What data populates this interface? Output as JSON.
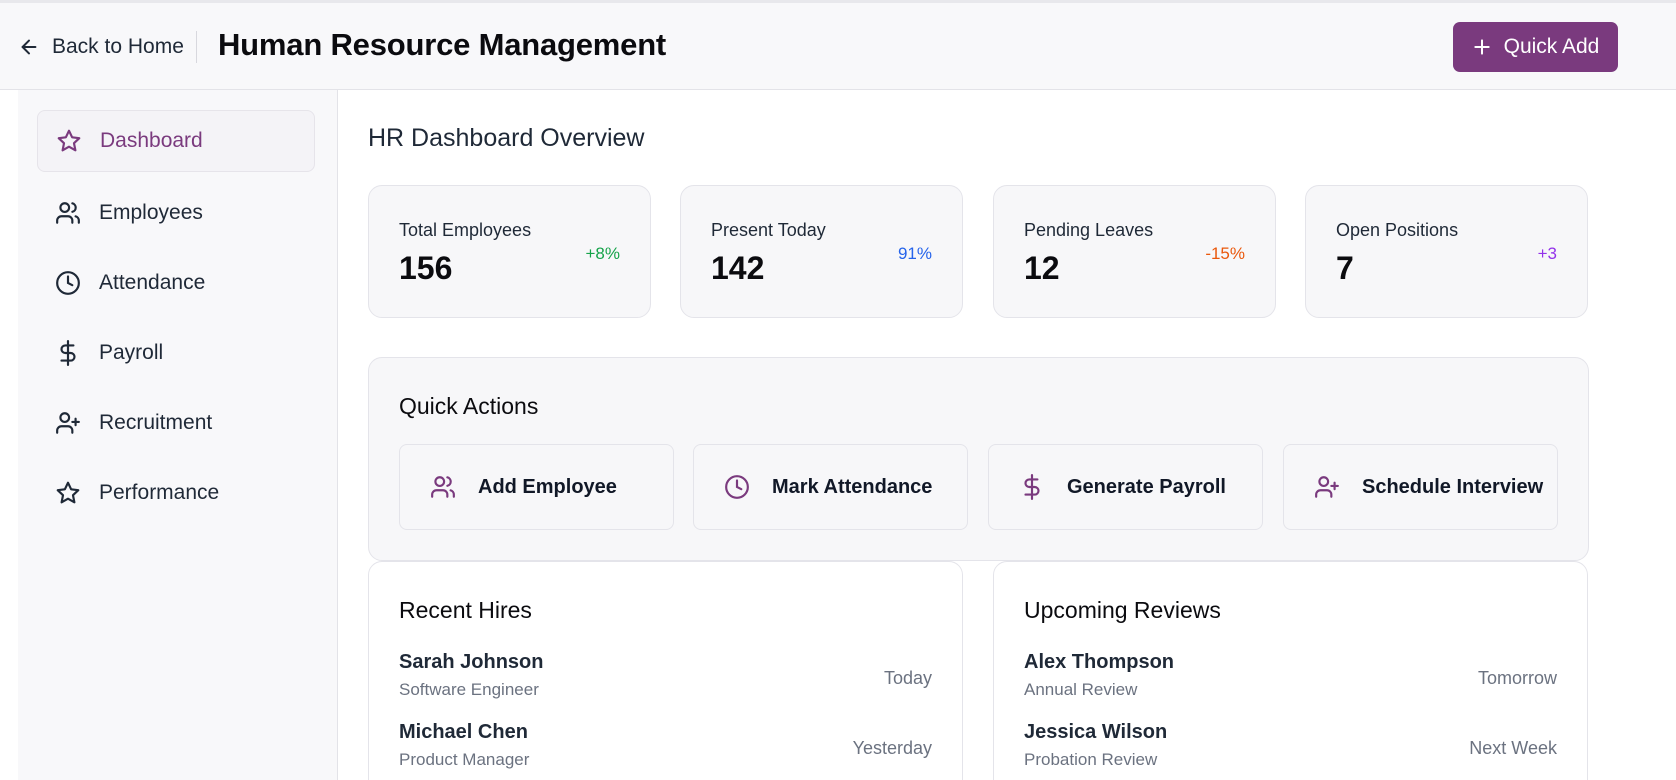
{
  "header": {
    "back_label": "Back to Home",
    "title": "Human Resource Management",
    "quick_add_label": "Quick Add"
  },
  "sidebar": {
    "items": [
      {
        "label": "Dashboard",
        "icon": "star-icon",
        "active": true
      },
      {
        "label": "Employees",
        "icon": "users-icon",
        "active": false
      },
      {
        "label": "Attendance",
        "icon": "clock-icon",
        "active": false
      },
      {
        "label": "Payroll",
        "icon": "dollar-icon",
        "active": false
      },
      {
        "label": "Recruitment",
        "icon": "user-plus-icon",
        "active": false
      },
      {
        "label": "Performance",
        "icon": "star-icon",
        "active": false
      }
    ]
  },
  "main": {
    "title": "HR Dashboard Overview",
    "stats": [
      {
        "label": "Total Employees",
        "value": "156",
        "change": "+8%",
        "color": "#16a34a"
      },
      {
        "label": "Present Today",
        "value": "142",
        "change": "91%",
        "color": "#2563eb"
      },
      {
        "label": "Pending Leaves",
        "value": "12",
        "change": "-15%",
        "color": "#ea580c"
      },
      {
        "label": "Open Positions",
        "value": "7",
        "change": "+3",
        "color": "#9333ea"
      }
    ],
    "quick_actions": {
      "title": "Quick Actions",
      "items": [
        {
          "label": "Add Employee",
          "icon": "users-icon"
        },
        {
          "label": "Mark Attendance",
          "icon": "clock-icon"
        },
        {
          "label": "Generate Payroll",
          "icon": "dollar-icon"
        },
        {
          "label": "Schedule Interview",
          "icon": "user-plus-icon"
        }
      ]
    },
    "recent_hires": {
      "title": "Recent Hires",
      "rows": [
        {
          "name": "Sarah Johnson",
          "role": "Software Engineer",
          "when": "Today"
        },
        {
          "name": "Michael Chen",
          "role": "Product Manager",
          "when": "Yesterday"
        }
      ]
    },
    "upcoming_reviews": {
      "title": "Upcoming Reviews",
      "rows": [
        {
          "name": "Alex Thompson",
          "role": "Annual Review",
          "when": "Tomorrow"
        },
        {
          "name": "Jessica Wilson",
          "role": "Probation Review",
          "when": "Next Week"
        }
      ]
    }
  },
  "colors": {
    "accent": "#7a3a7e",
    "panel_bg": "#f7f7f9",
    "border": "#e4e4ea"
  }
}
